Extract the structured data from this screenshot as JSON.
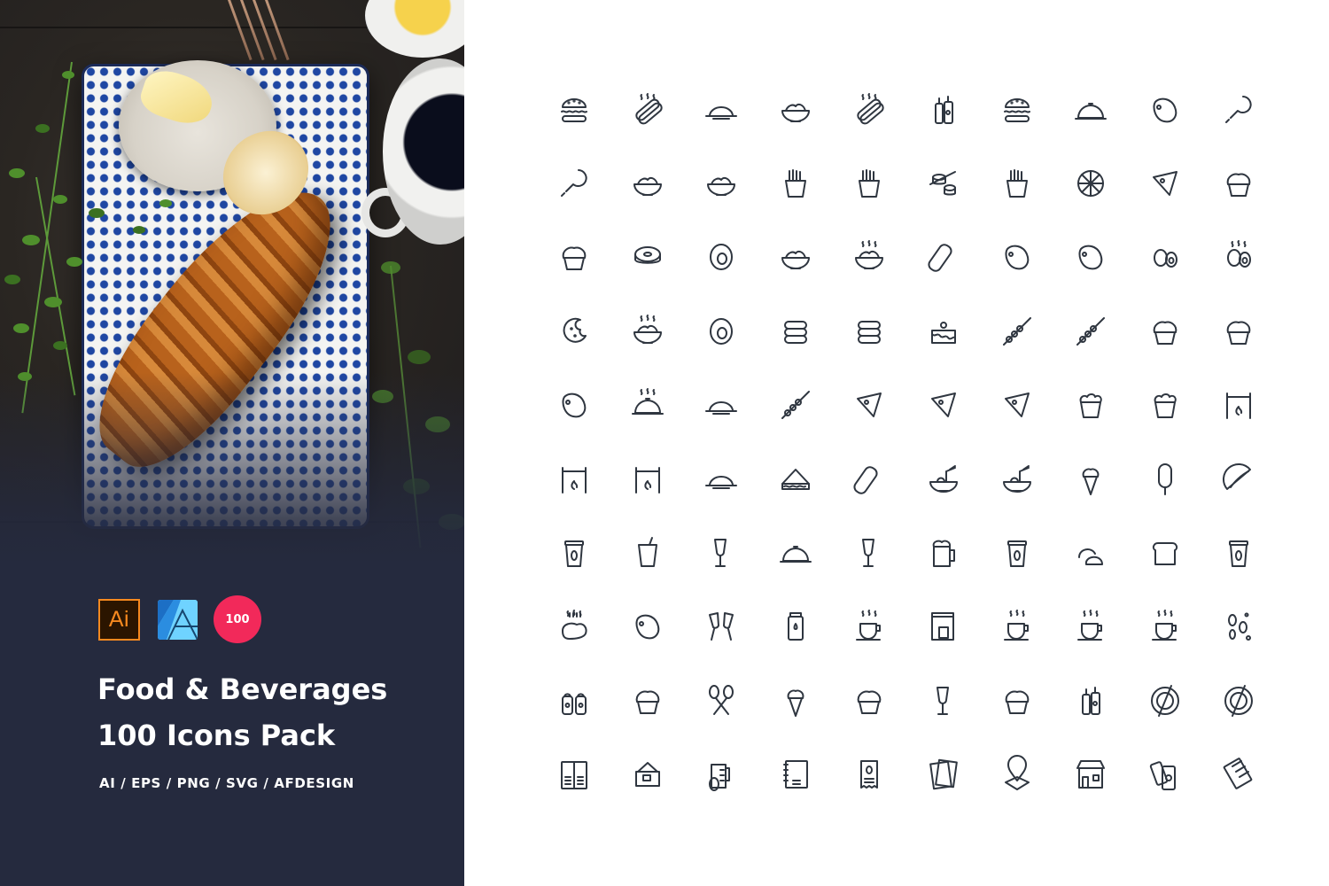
{
  "product": {
    "title_line1": "Food & Beverages",
    "title_line2": "100 Icons Pack",
    "formats": "AI / EPS / PNG / SVG / AFDESIGN",
    "badges": {
      "illustrator": "Ai",
      "affinity": "affinity-designer-icon",
      "count": "100"
    },
    "colors": {
      "panel_bg": "#252a3e",
      "count_badge": "#f2295a",
      "illustrator_orange": "#f7891f",
      "affinity_blue": "#47b6f4",
      "icon_stroke": "#2f3640"
    },
    "photo": "croissant-on-blue-patterned-plate-with-butter-coffee-and-herbs"
  },
  "icons": [
    "burger",
    "hot-dog",
    "roast-chicken-plate",
    "rice-bowl-chopsticks",
    "hot-dog-mustard",
    "ketchup-mustard-bottles",
    "burger-plain",
    "serving-cloche",
    "ham",
    "chicken-drumstick",
    "corn-dog",
    "salad-bowl",
    "noodle-bowl",
    "french-fries",
    "fries-with-dip",
    "sushi-rolls",
    "fries-wrapped",
    "pizza",
    "pizza-slice",
    "muffin",
    "cupcake-cherry",
    "donut",
    "donut-glazed",
    "rice-bowl",
    "hot-rice-bowl",
    "taco-wrap",
    "roast-turkey",
    "sliced-ham",
    "boiled-egg",
    "hot-boiled-egg",
    "cookie",
    "hot-soup",
    "fried-egg",
    "macaron",
    "pancake-stack",
    "cake-cherries",
    "meatball-skewer",
    "kebab-skewer",
    "pudding-cup",
    "pudding-cherry",
    "sliced-meat",
    "hot-cloche",
    "pie",
    "sausage-skewer",
    "cake-slice-cherry",
    "cheese-slice",
    "pizza-slice-small",
    "popcorn",
    "popcorn-drink",
    "rotisserie-grill",
    "spit-roast",
    "barbecue-grill",
    "jelly-pudding",
    "sandwich",
    "burrito",
    "ramen-bowl",
    "spaghetti-plate",
    "ice-cream-cone",
    "popsicle",
    "taco",
    "coffee-cup-to-go",
    "soda-cup",
    "cocktail-glass",
    "wine-glass-cloche",
    "milkshake",
    "beer-mug",
    "avocado-cup",
    "bread-buns",
    "bread-loaf",
    "coffee-and-bread",
    "hot-steak",
    "champagne-toast",
    "wine-toast",
    "milk-bottle",
    "hot-tea-cup",
    "coffee-machine",
    "coffee-cup-bean",
    "tea-cup-leaf",
    "coffee-and-croissant",
    "coffee-beans",
    "salt-pepper",
    "cupcake-candle",
    "spoons-crossed",
    "ice-cream-candle",
    "cocktail-cupcake",
    "martini-glasses",
    "ice-cream-cupcake",
    "sauce-bottle",
    "no-fish",
    "no-food",
    "menu-book",
    "cafe-sign",
    "coffee-measuring-jug",
    "recipe-notebook",
    "coffee-receipt",
    "flyer-menu",
    "restaurant-location",
    "food-shop",
    "coffee-cans",
    "chocolate-bar"
  ]
}
